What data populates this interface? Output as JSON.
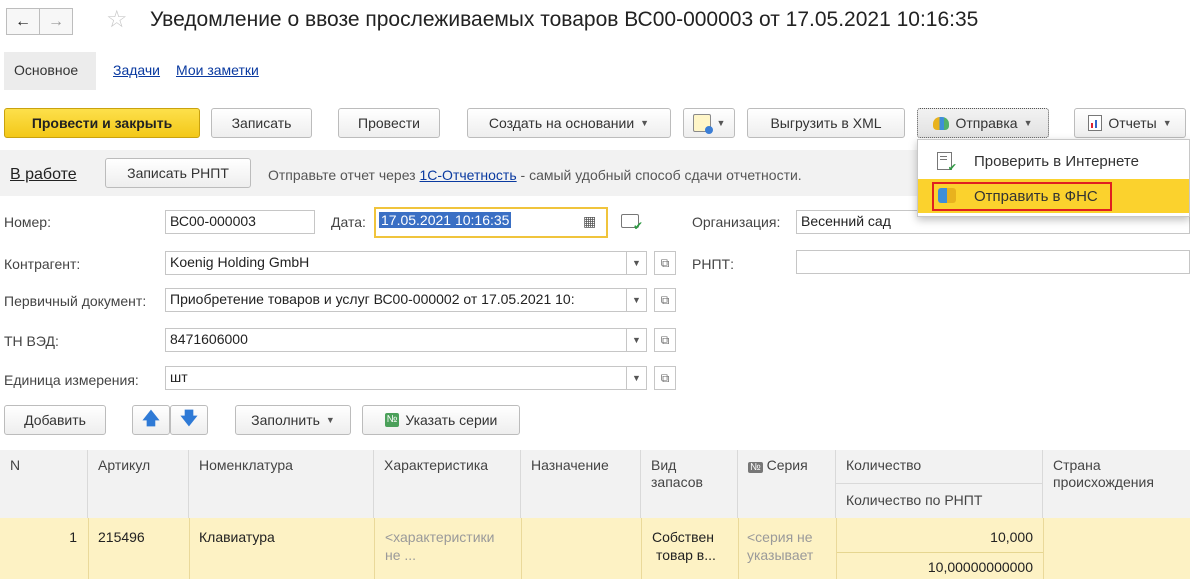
{
  "window": {
    "title": "Уведомление о ввозе прослеживаемых товаров ВС00-000003 от 17.05.2021 10:16:35"
  },
  "tabs": [
    {
      "label": "Основное"
    },
    {
      "label": "Задачи"
    },
    {
      "label": "Мои заметки"
    }
  ],
  "toolbar": {
    "post_close": "Провести и закрыть",
    "save": "Записать",
    "post": "Провести",
    "create_based": "Создать на основании",
    "export_xml": "Выгрузить в XML",
    "send": "Отправка",
    "reports": "Отчеты"
  },
  "send_menu": {
    "items": [
      {
        "label": "Проверить в Интернете"
      },
      {
        "label": "Отправить в ФНС"
      }
    ]
  },
  "status_bar": {
    "state": "В работе",
    "save_rnpt": "Записать РНПТ",
    "hint_prefix": "Отправьте отчет через",
    "hint_link": "1С-Отчетность",
    "hint_suffix": "- самый удобный способ сдачи отчетности."
  },
  "form": {
    "number_label": "Номер:",
    "number_value": "ВС00-000003",
    "date_label": "Дата:",
    "date_value": "17.05.2021 10:16:35",
    "org_label": "Организация:",
    "org_value": "Весенний сад",
    "counterparty_label": "Контрагент:",
    "counterparty_value": "Koenig Holding GmbH",
    "rnpt_label": "РНПТ:",
    "rnpt_value": "",
    "primary_doc_label": "Первичный документ:",
    "primary_doc_value": "Приобретение товаров и услуг ВС00-000002 от 17.05.2021 10:",
    "tnved_label": "ТН ВЭД:",
    "tnved_value": "8471606000",
    "unit_label": "Единица измерения:",
    "unit_value": "шт"
  },
  "table_toolbar": {
    "add": "Добавить",
    "fill": "Заполнить",
    "series": "Указать серии"
  },
  "table": {
    "headers": {
      "n": "N",
      "article": "Артикул",
      "nomenclature": "Номенклатура",
      "characteristic": "Характеристика",
      "purpose": "Назначение",
      "stock_type_1": "Вид",
      "stock_type_2": "запасов",
      "series": "Серия",
      "quantity": "Количество",
      "quantity_rnpt": "Количество по РНПТ",
      "country_1": "Страна",
      "country_2": "происхождения"
    },
    "rows": [
      {
        "n": "1",
        "article": "215496",
        "nomenclature": "Клавиатура",
        "characteristic_1": "<характеристики",
        "characteristic_2": "не ...",
        "purpose": "",
        "stock_type_1": "Собствен",
        "stock_type_2": "товар в...",
        "series_1": "<серия не",
        "series_2": "указывает",
        "quantity": "10,000",
        "quantity_rnpt": "10,00000000000",
        "country": ""
      }
    ]
  },
  "colors": {
    "primary_button": "#f3c818",
    "highlight": "#fbd22d",
    "row_selected": "#fdf2c4",
    "link": "#0a3aa0",
    "date_focus_border": "#f0c43c",
    "date_selection": "#3a6fc4"
  },
  "icons": [
    "back-arrow-icon",
    "forward-arrow-icon",
    "star-icon",
    "calendar-icon",
    "check-document-icon",
    "open-icon",
    "dropdown-icon",
    "up-arrow-icon",
    "down-arrow-icon",
    "series-number-icon",
    "send-cloud-icon",
    "report-icon",
    "check-internet-icon",
    "send-fns-icon",
    "history-icon"
  ]
}
